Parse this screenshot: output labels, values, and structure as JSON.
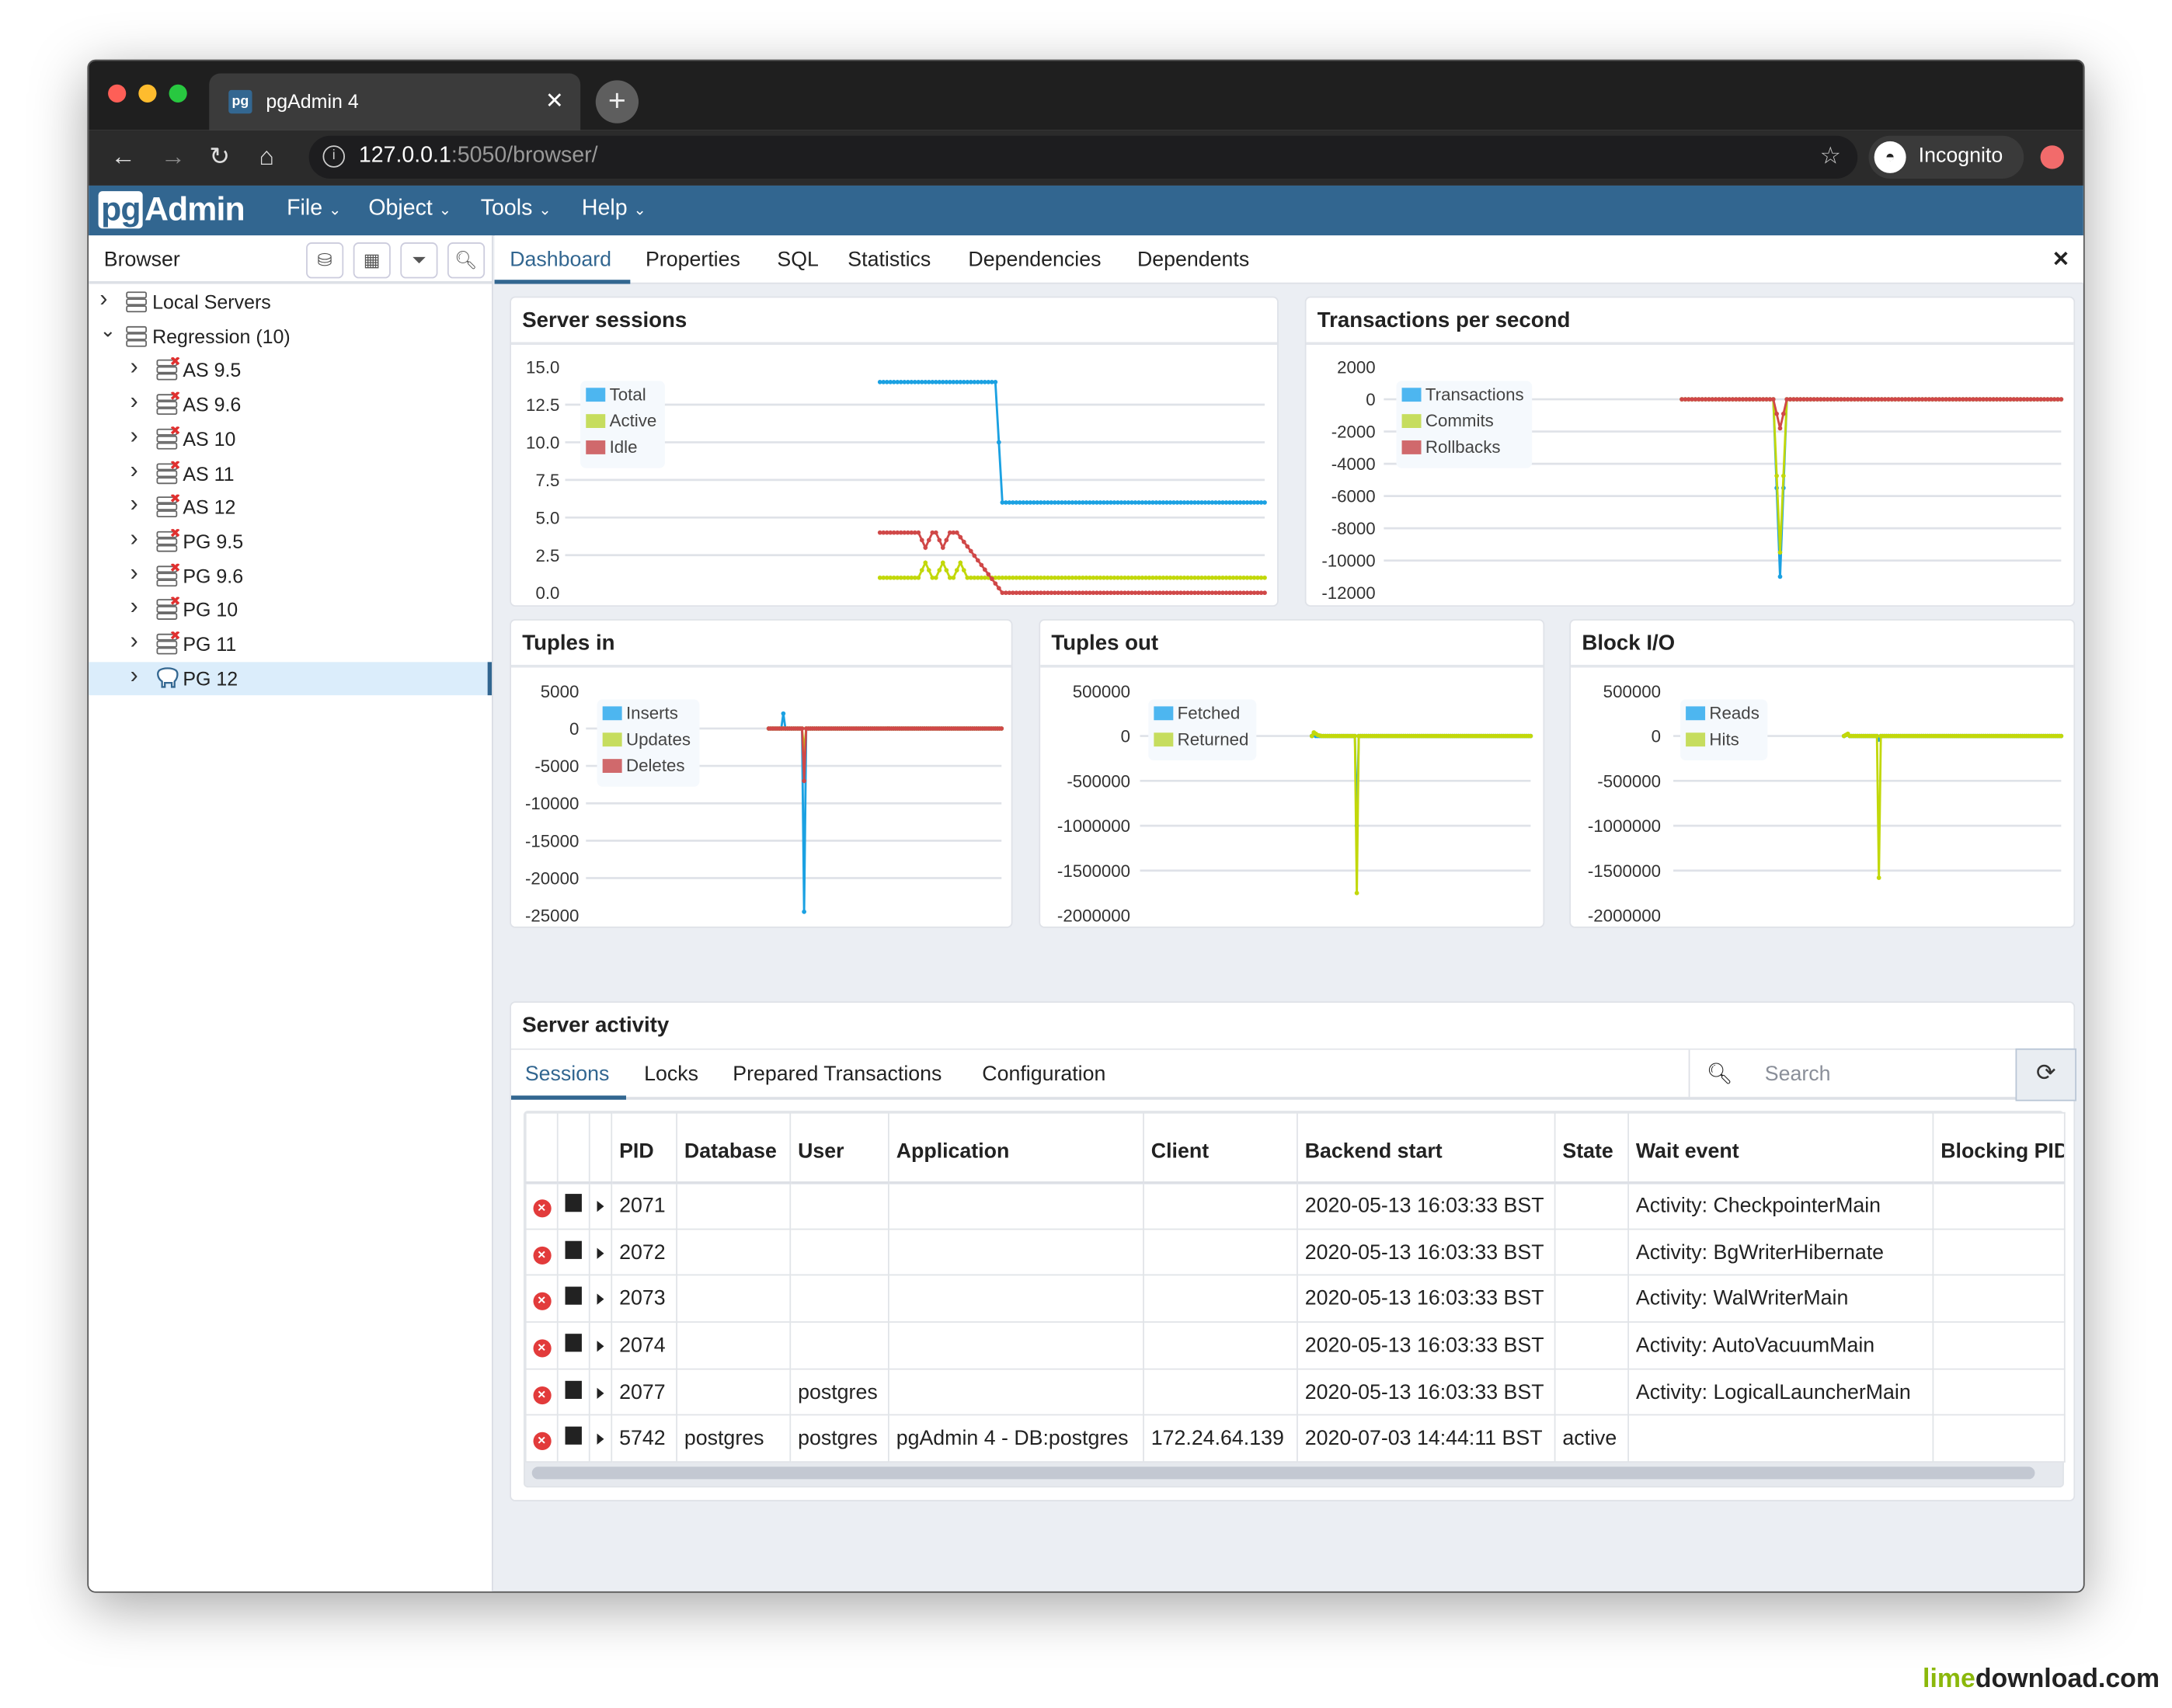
{
  "browser": {
    "tab_title": "pgAdmin 4",
    "tab_favicon": "pg",
    "url_host": "127.0.0.1",
    "url_rest": ":5050/browser/",
    "profile_label": "Incognito"
  },
  "app": {
    "logo_pg": "pg",
    "logo_admin": "Admin",
    "menus": [
      {
        "label": "File"
      },
      {
        "label": "Object"
      },
      {
        "label": "Tools"
      },
      {
        "label": "Help"
      }
    ]
  },
  "tree": {
    "title": "Browser",
    "items": [
      {
        "label": "Local Servers",
        "level": 0,
        "expanded": false,
        "icon": "server-group"
      },
      {
        "label": "Regression (10)",
        "level": 0,
        "expanded": true,
        "icon": "server-group"
      },
      {
        "label": "AS 9.5",
        "level": 1,
        "icon": "server-disconnected"
      },
      {
        "label": "AS 9.6",
        "level": 1,
        "icon": "server-disconnected"
      },
      {
        "label": "AS 10",
        "level": 1,
        "icon": "server-disconnected"
      },
      {
        "label": "AS 11",
        "level": 1,
        "icon": "server-disconnected"
      },
      {
        "label": "AS 12",
        "level": 1,
        "icon": "server-disconnected"
      },
      {
        "label": "PG 9.5",
        "level": 1,
        "icon": "server-disconnected"
      },
      {
        "label": "PG 9.6",
        "level": 1,
        "icon": "server-disconnected"
      },
      {
        "label": "PG 10",
        "level": 1,
        "icon": "server-disconnected"
      },
      {
        "label": "PG 11",
        "level": 1,
        "icon": "server-disconnected"
      },
      {
        "label": "PG 12",
        "level": 1,
        "icon": "elephant",
        "selected": true
      }
    ]
  },
  "tabs": [
    {
      "label": "Dashboard",
      "active": true
    },
    {
      "label": "Properties"
    },
    {
      "label": "SQL"
    },
    {
      "label": "Statistics"
    },
    {
      "label": "Dependencies"
    },
    {
      "label": "Dependents"
    }
  ],
  "colors": {
    "blue": "#1ba1e2",
    "green": "#c2d80a",
    "red": "#d04848",
    "header": "#326690"
  },
  "chart_data": [
    {
      "type": "line",
      "title": "Server sessions",
      "ylim": [
        0,
        15
      ],
      "yticks": [
        "0.0",
        "2.5",
        "5.0",
        "7.5",
        "10.0",
        "12.5",
        "15.0"
      ],
      "xrange": [
        0,
        200
      ],
      "legend": "top-left",
      "grid": true,
      "series": [
        {
          "name": "Total",
          "color": "#1ba1e2",
          "legend_color": "#4db6f0",
          "points": [
            [
              90,
              14
            ],
            [
              123,
              14
            ],
            [
              125,
              6
            ],
            [
              200,
              6
            ]
          ]
        },
        {
          "name": "Active",
          "color": "#c2d80a",
          "legend_color": "#c6dd5e",
          "points": [
            [
              90,
              1
            ],
            [
              101,
              1
            ],
            [
              103,
              2
            ],
            [
              105,
              1
            ],
            [
              106,
              1
            ],
            [
              108,
              2
            ],
            [
              110,
              1
            ],
            [
              111,
              1
            ],
            [
              113,
              2
            ],
            [
              115,
              1
            ],
            [
              200,
              1
            ]
          ]
        },
        {
          "name": "Idle",
          "color": "#d04848",
          "legend_color": "#d0696c",
          "points": [
            [
              90,
              4
            ],
            [
              101,
              4
            ],
            [
              103,
              3
            ],
            [
              105,
              4
            ],
            [
              106,
              4
            ],
            [
              108,
              3
            ],
            [
              110,
              4
            ],
            [
              112,
              4
            ],
            [
              125,
              0
            ],
            [
              200,
              0
            ]
          ]
        }
      ]
    },
    {
      "type": "line",
      "title": "Transactions per second",
      "ylim": [
        -12000,
        2000
      ],
      "yticks": [
        "-12000",
        "-10000",
        "-8000",
        "-6000",
        "-4000",
        "-2000",
        "0",
        "2000"
      ],
      "xrange": [
        0,
        200
      ],
      "legend": "top-left",
      "grid": true,
      "series": [
        {
          "name": "Transactions",
          "color": "#1ba1e2",
          "legend_color": "#4db6f0",
          "points": [
            [
              88,
              0
            ],
            [
              115,
              0
            ],
            [
              117,
              -11000
            ],
            [
              119,
              0
            ],
            [
              200,
              0
            ]
          ]
        },
        {
          "name": "Commits",
          "color": "#c2d80a",
          "legend_color": "#c6dd5e",
          "points": [
            [
              88,
              0
            ],
            [
              115,
              0
            ],
            [
              117,
              -9500
            ],
            [
              119,
              0
            ],
            [
              200,
              0
            ]
          ]
        },
        {
          "name": "Rollbacks",
          "color": "#d04848",
          "legend_color": "#d0696c",
          "points": [
            [
              88,
              0
            ],
            [
              115,
              0
            ],
            [
              117,
              -1800
            ],
            [
              119,
              0
            ],
            [
              200,
              0
            ]
          ]
        }
      ]
    },
    {
      "type": "line",
      "title": "Tuples in",
      "ylim": [
        -25000,
        5000
      ],
      "yticks": [
        "-25000",
        "-20000",
        "-15000",
        "-10000",
        "-5000",
        "0",
        "5000"
      ],
      "xrange": [
        0,
        200
      ],
      "legend": "top-left",
      "grid": true,
      "series": [
        {
          "name": "Inserts",
          "color": "#1ba1e2",
          "legend_color": "#4db6f0",
          "points": [
            [
              88,
              0
            ],
            [
              94,
              0
            ],
            [
              95,
              2000
            ],
            [
              96,
              0
            ],
            [
              104,
              0
            ],
            [
              105,
              -24500
            ],
            [
              106,
              0
            ],
            [
              200,
              0
            ]
          ]
        },
        {
          "name": "Updates",
          "color": "#c2d80a",
          "legend_color": "#c6dd5e",
          "points": [
            [
              88,
              0
            ],
            [
              104,
              0
            ],
            [
              105,
              -3000
            ],
            [
              106,
              0
            ],
            [
              200,
              0
            ]
          ]
        },
        {
          "name": "Deletes",
          "color": "#d04848",
          "legend_color": "#d0696c",
          "points": [
            [
              88,
              0
            ],
            [
              104,
              0
            ],
            [
              105,
              -7000
            ],
            [
              106,
              0
            ],
            [
              200,
              0
            ]
          ]
        }
      ]
    },
    {
      "type": "line",
      "title": "Tuples out",
      "ylim": [
        -2000000,
        500000
      ],
      "yticks": [
        "-2000000",
        "-1500000",
        "-1000000",
        "-500000",
        "0",
        "500000"
      ],
      "xrange": [
        0,
        200
      ],
      "legend": "top-left",
      "grid": true,
      "series": [
        {
          "name": "Fetched",
          "color": "#1ba1e2",
          "legend_color": "#4db6f0",
          "points": [
            [
              88,
              0
            ],
            [
              89,
              30000
            ],
            [
              90,
              0
            ],
            [
              110,
              0
            ],
            [
              111,
              -1000000
            ],
            [
              112,
              0
            ],
            [
              200,
              0
            ]
          ]
        },
        {
          "name": "Returned",
          "color": "#c2d80a",
          "legend_color": "#c6dd5e",
          "points": [
            [
              88,
              0
            ],
            [
              89,
              40000
            ],
            [
              91,
              10000
            ],
            [
              93,
              0
            ],
            [
              110,
              0
            ],
            [
              111,
              -1750000
            ],
            [
              112,
              0
            ],
            [
              200,
              0
            ]
          ]
        }
      ]
    },
    {
      "type": "line",
      "title": "Block I/O",
      "ylim": [
        -2000000,
        500000
      ],
      "yticks": [
        "-2000000",
        "-1500000",
        "-1000000",
        "-500000",
        "0",
        "500000"
      ],
      "xrange": [
        0,
        200
      ],
      "legend": "top-left",
      "grid": true,
      "series": [
        {
          "name": "Reads",
          "color": "#1ba1e2",
          "legend_color": "#4db6f0",
          "points": [
            [
              88,
              0
            ],
            [
              90,
              20000
            ],
            [
              91,
              0
            ],
            [
              105,
              0
            ],
            [
              106,
              -40000
            ],
            [
              107,
              0
            ],
            [
              200,
              0
            ]
          ]
        },
        {
          "name": "Hits",
          "color": "#c2d80a",
          "legend_color": "#c6dd5e",
          "points": [
            [
              88,
              0
            ],
            [
              90,
              25000
            ],
            [
              91,
              0
            ],
            [
              105,
              0
            ],
            [
              106,
              -1580000
            ],
            [
              107,
              0
            ],
            [
              200,
              0
            ]
          ]
        }
      ]
    }
  ],
  "activity": {
    "title": "Server activity",
    "tabs": [
      {
        "label": "Sessions",
        "active": true
      },
      {
        "label": "Locks"
      },
      {
        "label": "Prepared Transactions"
      },
      {
        "label": "Configuration"
      }
    ],
    "search_placeholder": "Search",
    "columns": [
      "PID",
      "Database",
      "User",
      "Application",
      "Client",
      "Backend start",
      "State",
      "Wait event",
      "Blocking PIDs"
    ],
    "rows": [
      [
        "2071",
        "",
        "",
        "",
        "",
        "2020-05-13 16:03:33 BST",
        "",
        "Activity: CheckpointerMain",
        ""
      ],
      [
        "2072",
        "",
        "",
        "",
        "",
        "2020-05-13 16:03:33 BST",
        "",
        "Activity: BgWriterHibernate",
        ""
      ],
      [
        "2073",
        "",
        "",
        "",
        "",
        "2020-05-13 16:03:33 BST",
        "",
        "Activity: WalWriterMain",
        ""
      ],
      [
        "2074",
        "",
        "",
        "",
        "",
        "2020-05-13 16:03:33 BST",
        "",
        "Activity: AutoVacuumMain",
        ""
      ],
      [
        "2077",
        "",
        "postgres",
        "",
        "",
        "2020-05-13 16:03:33 BST",
        "",
        "Activity: LogicalLauncherMain",
        ""
      ],
      [
        "5742",
        "postgres",
        "postgres",
        "pgAdmin 4 - DB:postgres",
        "172.24.64.139",
        "2020-07-03 14:44:11 BST",
        "active",
        "",
        ""
      ]
    ]
  },
  "watermark": {
    "part1": "lime",
    "part2": "download.com"
  }
}
